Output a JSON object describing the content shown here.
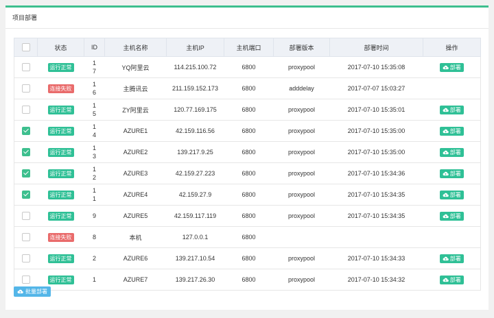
{
  "panel": {
    "title": "项目部署"
  },
  "table": {
    "headers": [
      "状态",
      "ID",
      "主机名称",
      "主机IP",
      "主机端口",
      "部署版本",
      "部署时间",
      "操作"
    ],
    "rows": [
      {
        "checked": false,
        "status": "运行正常",
        "status_type": "ok",
        "id": "17",
        "name": "YQ阿里云",
        "ip": "114.215.100.72",
        "port": "6800",
        "version": "proxypool",
        "time": "2017-07-10 15:35:08",
        "action": "部署"
      },
      {
        "checked": false,
        "status": "连接失败",
        "status_type": "fail",
        "id": "16",
        "name": "主腾讯云",
        "ip": "211.159.152.173",
        "port": "6800",
        "version": "adddelay",
        "time": "2017-07-07 15:03:27",
        "action": ""
      },
      {
        "checked": false,
        "status": "运行正常",
        "status_type": "ok",
        "id": "15",
        "name": "ZY阿里云",
        "ip": "120.77.169.175",
        "port": "6800",
        "version": "proxypool",
        "time": "2017-07-10 15:35:01",
        "action": "部署"
      },
      {
        "checked": true,
        "status": "运行正常",
        "status_type": "ok",
        "id": "14",
        "name": "AZURE1",
        "ip": "42.159.116.56",
        "port": "6800",
        "version": "proxypool",
        "time": "2017-07-10 15:35:00",
        "action": "部署"
      },
      {
        "checked": true,
        "status": "运行正常",
        "status_type": "ok",
        "id": "13",
        "name": "AZURE2",
        "ip": "139.217.9.25",
        "port": "6800",
        "version": "proxypool",
        "time": "2017-07-10 15:35:00",
        "action": "部署"
      },
      {
        "checked": true,
        "status": "运行正常",
        "status_type": "ok",
        "id": "12",
        "name": "AZURE3",
        "ip": "42.159.27.223",
        "port": "6800",
        "version": "proxypool",
        "time": "2017-07-10 15:34:36",
        "action": "部署"
      },
      {
        "checked": true,
        "status": "运行正常",
        "status_type": "ok",
        "id": "11",
        "name": "AZURE4",
        "ip": "42.159.27.9",
        "port": "6800",
        "version": "proxypool",
        "time": "2017-07-10 15:34:35",
        "action": "部署"
      },
      {
        "checked": false,
        "status": "运行正常",
        "status_type": "ok",
        "id": "9",
        "name": "AZURE5",
        "ip": "42.159.117.119",
        "port": "6800",
        "version": "proxypool",
        "time": "2017-07-10 15:34:35",
        "action": "部署"
      },
      {
        "checked": false,
        "status": "连接失败",
        "status_type": "fail",
        "id": "8",
        "name": "本机",
        "ip": "127.0.0.1",
        "port": "6800",
        "version": "",
        "time": "",
        "action": ""
      },
      {
        "checked": false,
        "status": "运行正常",
        "status_type": "ok",
        "id": "2",
        "name": "AZURE6",
        "ip": "139.217.10.54",
        "port": "6800",
        "version": "proxypool",
        "time": "2017-07-10 15:34:33",
        "action": "部署"
      },
      {
        "checked": false,
        "status": "运行正常",
        "status_type": "ok",
        "id": "1",
        "name": "AZURE7",
        "ip": "139.217.26.30",
        "port": "6800",
        "version": "proxypool",
        "time": "2017-07-10 15:34:32",
        "action": "部署"
      }
    ]
  },
  "batch": {
    "label": "批量部署"
  },
  "colors": {
    "accent": "#3dbf8e",
    "ok": "#2fc096",
    "fail": "#e96b6b",
    "batch": "#54b6e8"
  },
  "icons": {
    "deploy": "cloud-upload-icon"
  }
}
